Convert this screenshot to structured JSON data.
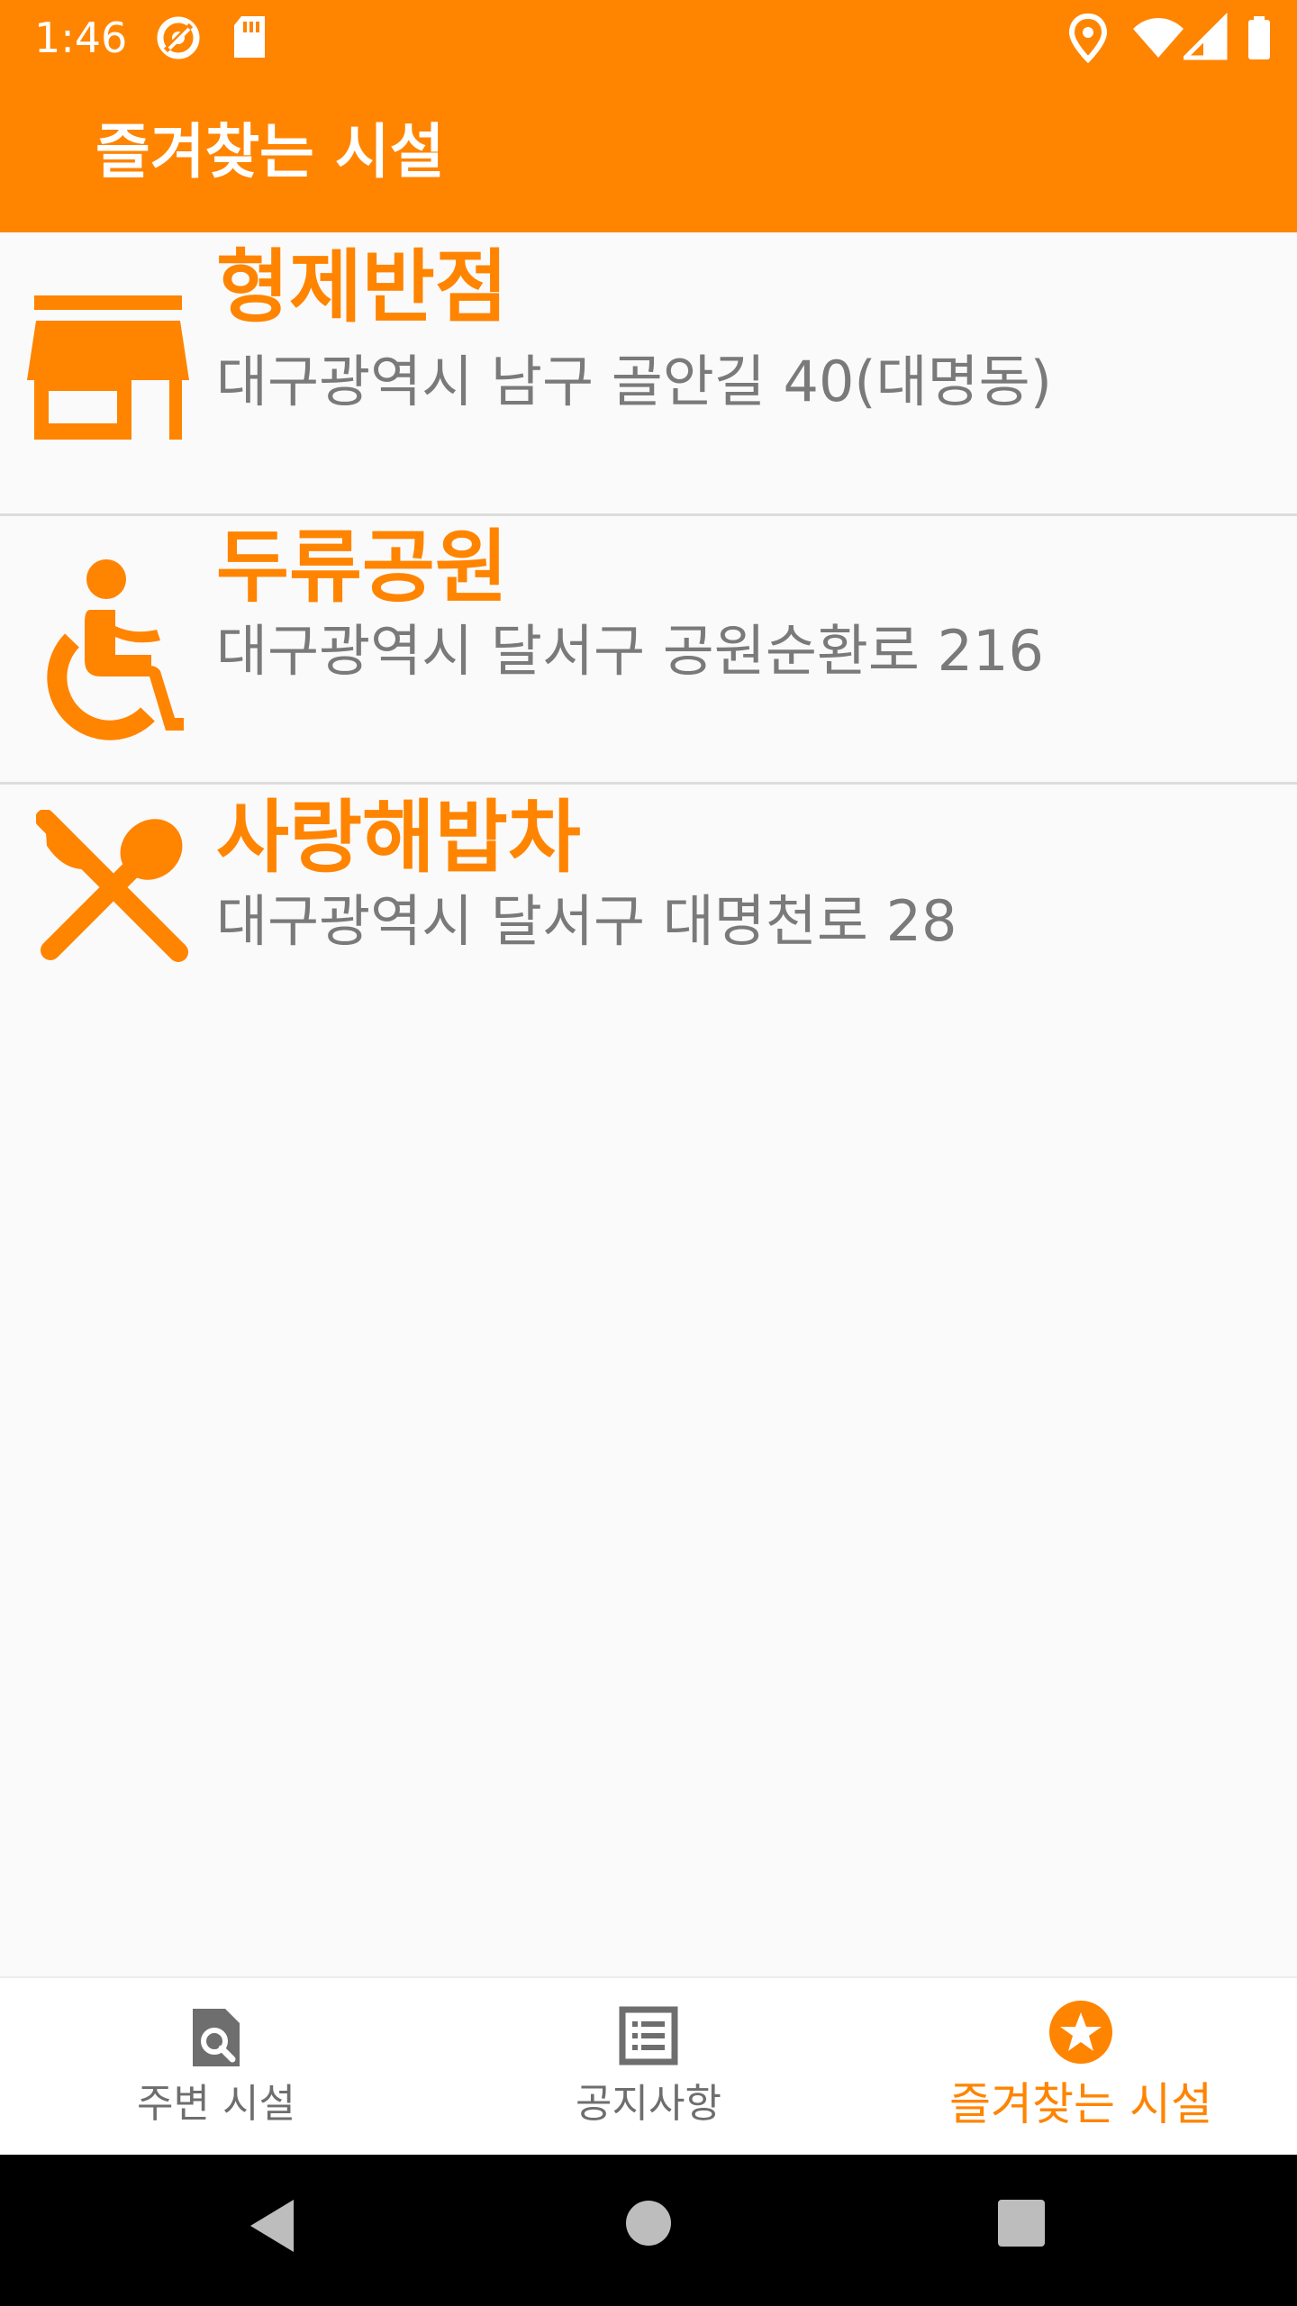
{
  "status_bar": {
    "time": "1:46",
    "icons": [
      "sync-icon",
      "sd-card-icon",
      "location-icon",
      "wifi-icon",
      "signal-icon",
      "battery-icon"
    ]
  },
  "app_bar": {
    "title": "즐겨찾는 시설"
  },
  "facilities": [
    {
      "name": "형제반점",
      "address": "대구광역시 남구 골안길 40(대명동)",
      "icon": "store-icon"
    },
    {
      "name": "두류공원",
      "address": "대구광역시 달서구 공원순환로 216",
      "icon": "wheelchair-icon"
    },
    {
      "name": "사랑해밥차",
      "address": "대구광역시 달서구 대명천로 28",
      "icon": "restaurant-icon"
    }
  ],
  "bottom_nav": {
    "items": [
      {
        "label": "주변 시설",
        "icon": "search-document-icon",
        "active": false
      },
      {
        "label": "공지사항",
        "icon": "list-icon",
        "active": false
      },
      {
        "label": "즐겨찾는 시설",
        "icon": "star-icon",
        "active": true
      }
    ]
  },
  "system_nav": {
    "buttons": [
      "back-icon",
      "home-icon",
      "recents-icon"
    ]
  },
  "colors": {
    "accent": "#ff8400",
    "background": "#fafafa",
    "address_text": "#7a7a7a",
    "inactive_nav": "#6e6e6e"
  }
}
